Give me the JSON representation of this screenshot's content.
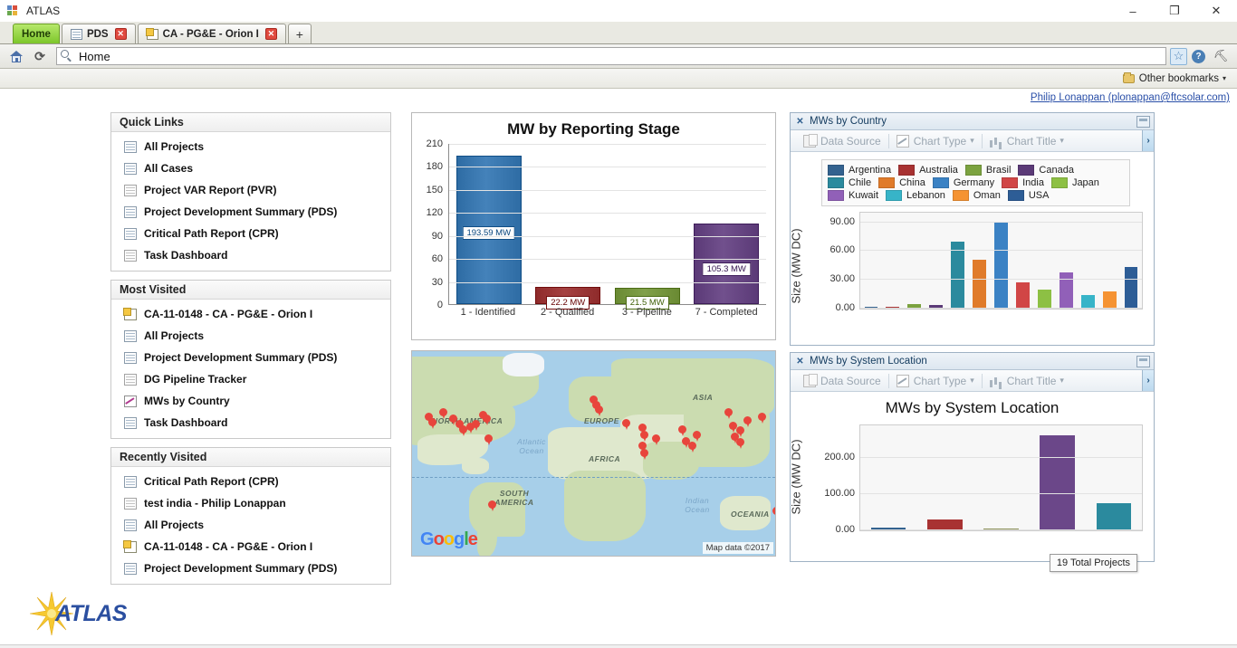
{
  "window": {
    "title": "ATLAS",
    "minimize": "–",
    "restore": "❐",
    "close": "✕"
  },
  "tabs": [
    {
      "label": "Home",
      "icon": "none",
      "active": true,
      "closable": false
    },
    {
      "label": "PDS",
      "icon": "grid-icon",
      "active": false,
      "closable": true
    },
    {
      "label": "CA - PG&E - Orion I",
      "icon": "project-icon",
      "active": false,
      "closable": true
    }
  ],
  "new_tab_label": "+",
  "toolbar": {
    "home_icon": "home-icon",
    "reload_icon": "reload-icon",
    "search_icon": "search-icon",
    "address_value": "Home",
    "star_icon": "☆",
    "help_icon": "?",
    "wrench_icon": "🔧"
  },
  "bookmarks": {
    "other_label": "Other bookmarks",
    "caret": "▾"
  },
  "user": {
    "link": "Philip Lonappan (plonappan@ftcsolar.com)"
  },
  "sidebar": {
    "sections": [
      {
        "title": "Quick Links",
        "items": [
          {
            "label": "All Projects",
            "icon": "grid-icon"
          },
          {
            "label": "All Cases",
            "icon": "grid-icon"
          },
          {
            "label": "Project VAR Report (PVR)",
            "icon": "grid-icon-gray"
          },
          {
            "label": "Project Development Summary (PDS)",
            "icon": "grid-icon"
          },
          {
            "label": "Critical Path Report (CPR)",
            "icon": "grid-icon"
          },
          {
            "label": "Task Dashboard",
            "icon": "grid-icon-gray"
          }
        ]
      },
      {
        "title": "Most Visited",
        "items": [
          {
            "label": "CA-11-0148 - CA - PG&E - Orion I",
            "icon": "project-icon"
          },
          {
            "label": "All Projects",
            "icon": "grid-icon"
          },
          {
            "label": "Project Development Summary (PDS)",
            "icon": "grid-icon"
          },
          {
            "label": "DG Pipeline Tracker",
            "icon": "grid-icon-gray"
          },
          {
            "label": "MWs by Country",
            "icon": "chart-icon"
          },
          {
            "label": "Task Dashboard",
            "icon": "grid-icon"
          }
        ]
      },
      {
        "title": "Recently Visited",
        "items": [
          {
            "label": "Critical Path Report (CPR)",
            "icon": "grid-icon"
          },
          {
            "label": "test india - Philip Lonappan",
            "icon": "grid-icon-gray"
          },
          {
            "label": "All Projects",
            "icon": "grid-icon"
          },
          {
            "label": "CA-11-0148 - CA - PG&E - Orion I",
            "icon": "project-icon"
          },
          {
            "label": "Project Development Summary (PDS)",
            "icon": "grid-icon"
          }
        ]
      }
    ]
  },
  "map": {
    "labels": [
      "NORTH AMERICA",
      "SOUTH AMERICA",
      "AFRICA",
      "EUROPE",
      "ASIA",
      "OCEANIA"
    ],
    "ocean_labels": [
      "Atlantic Ocean",
      "Indian Ocean"
    ],
    "attribution": "Map data ©2017",
    "brand": "Google",
    "marker_count": 28
  },
  "panels": [
    {
      "title": "MWs by Country",
      "close_icon": "✕",
      "minimize_icon": "minimize-icon",
      "expand_icon": "›",
      "toolbar": [
        {
          "label": "Data Source",
          "icon": "data-source-icon",
          "caret": ""
        },
        {
          "label": "Chart Type",
          "icon": "chart-type-icon",
          "caret": "▾"
        },
        {
          "label": "Chart Title",
          "icon": "chart-title-icon",
          "caret": "▾"
        }
      ]
    },
    {
      "title": "MWs by System Location",
      "close_icon": "✕",
      "minimize_icon": "minimize-icon",
      "expand_icon": "›",
      "toolbar": [
        {
          "label": "Data Source",
          "icon": "data-source-icon",
          "caret": ""
        },
        {
          "label": "Chart Type",
          "icon": "chart-type-icon",
          "caret": "▾"
        },
        {
          "label": "Chart Title",
          "icon": "chart-title-icon",
          "caret": "▾"
        }
      ]
    }
  ],
  "chart_data": [
    {
      "id": "mw_by_reporting_stage",
      "type": "bar",
      "title": "MW by Reporting Stage",
      "xlabel": "",
      "ylabel": "",
      "categories": [
        "1 - Identified",
        "2 - Qualified",
        "3 - Pipeline",
        "7 - Completed"
      ],
      "values": [
        193.59,
        22.2,
        21.5,
        105.3
      ],
      "data_labels": [
        "193.59 MW",
        "22.2 MW",
        "21.5 MW",
        "105.3 MW"
      ],
      "colors": [
        "#2e6ca4",
        "#8f2b2b",
        "#6a8a33",
        "#5b3a77"
      ],
      "ylim": [
        0,
        210
      ],
      "yticks": [
        0,
        30,
        60,
        90,
        120,
        150,
        180,
        210
      ],
      "grid": true,
      "legend": "none"
    },
    {
      "id": "mws_by_country",
      "type": "bar",
      "title": "",
      "xlabel": "",
      "ylabel": "Size (MW DC)",
      "categories": [
        "Argentina",
        "Australia",
        "Brasil",
        "Canada",
        "Chile",
        "China",
        "Germany",
        "India",
        "Japan",
        "Kuwait",
        "Lebanon",
        "Oman",
        "USA"
      ],
      "values": [
        1.0,
        0.8,
        5.0,
        4.0,
        69.5,
        51.0,
        90.5,
        27.0,
        20.0,
        38.0,
        14.0,
        18.0,
        43.0
      ],
      "colors": [
        "#33628f",
        "#a83232",
        "#7ba23f",
        "#5b3a77",
        "#2b8a9e",
        "#e07b2a",
        "#3b82c4",
        "#d14646",
        "#8dc044",
        "#9160b8",
        "#37b4c8",
        "#f59332",
        "#2d5d96"
      ],
      "ylim": [
        0,
        100
      ],
      "yticks": [
        0,
        30,
        60,
        90
      ],
      "ytick_labels": [
        "0.00",
        "30.00",
        "60.00",
        "90.00"
      ],
      "grid": true,
      "legend": "top",
      "legend_entries": [
        {
          "label": "Argentina",
          "color": "#33628f"
        },
        {
          "label": "Australia",
          "color": "#a83232"
        },
        {
          "label": "Brasil",
          "color": "#7ba23f"
        },
        {
          "label": "Canada",
          "color": "#5b3a77"
        },
        {
          "label": "Chile",
          "color": "#2b8a9e"
        },
        {
          "label": "China",
          "color": "#e07b2a"
        },
        {
          "label": "Germany",
          "color": "#3b82c4"
        },
        {
          "label": "India",
          "color": "#d14646"
        },
        {
          "label": "Japan",
          "color": "#8dc044"
        },
        {
          "label": "Kuwait",
          "color": "#9160b8"
        },
        {
          "label": "Lebanon",
          "color": "#37b4c8"
        },
        {
          "label": "Oman",
          "color": "#f59332"
        },
        {
          "label": "USA",
          "color": "#2d5d96"
        }
      ]
    },
    {
      "id": "mws_by_system_location",
      "type": "bar",
      "title": "MWs by System Location",
      "xlabel": "",
      "ylabel": "Size (MW DC)",
      "categories": [
        "",
        "",
        "",
        "",
        ""
      ],
      "values": [
        8.0,
        30.0,
        2.0,
        262.0,
        75.0
      ],
      "colors": [
        "#33628f",
        "#a83232",
        "#8a8f55",
        "#6b4789",
        "#2b8a9e"
      ],
      "ylim": [
        0,
        290
      ],
      "yticks": [
        0,
        100,
        200
      ],
      "ytick_labels": [
        "0.00",
        "100.00",
        "200.00"
      ],
      "grid": true,
      "legend": "none",
      "tooltip": "19 Total Projects"
    }
  ],
  "logo": {
    "text": "ATLAS"
  }
}
